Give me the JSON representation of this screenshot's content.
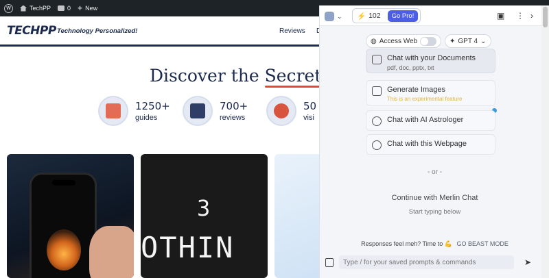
{
  "adminbar": {
    "site_name": "TechPP",
    "comments_count": "0",
    "new_label": "New"
  },
  "site": {
    "logo": "TECHPP",
    "tagline": "Technology Personalized!",
    "nav_reviews": "Reviews",
    "nav_more": "D"
  },
  "hero": {
    "title_before": "Discover the ",
    "title_highlight": "Secrets",
    "stats": [
      {
        "num": "1250+",
        "label": "guides"
      },
      {
        "num": "700+",
        "label": "reviews"
      },
      {
        "num": "50",
        "label": "visi"
      }
    ]
  },
  "cards": {
    "card2_digit": "3",
    "card2_text": "OTHIN"
  },
  "merlin": {
    "credits": "102",
    "gopro": "Go Pro!",
    "access_web": "Access Web",
    "model": "GPT 4",
    "options": [
      {
        "title": "Chat with your Documents",
        "sub": "pdf, doc, pptx, txt",
        "icon": "document-icon"
      },
      {
        "title": "Generate Images",
        "sub": "This is an experimental feature",
        "icon": "image-icon"
      },
      {
        "title": "Chat with AI Astrologer",
        "sub": "",
        "icon": "astrologer-icon"
      },
      {
        "title": "Chat with this Webpage",
        "sub": "",
        "icon": "globe-icon"
      }
    ],
    "or_text": "- or -",
    "continue_title": "Continue with Merlin Chat",
    "continue_sub": "Start typing below",
    "meh_text": "Responses feel meh? Time to",
    "beast_mode": "GO BEAST MODE",
    "input_placeholder": "Type / for your saved prompts & commands"
  },
  "colors": {
    "brand_navy": "#1b2a4e",
    "accent_red": "#e24b2b",
    "gopro_blue": "#4c5de7"
  }
}
